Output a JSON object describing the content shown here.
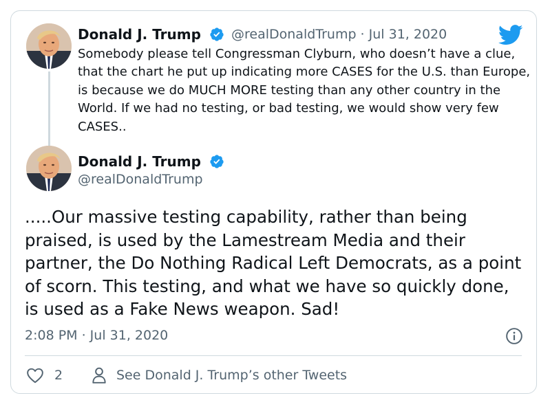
{
  "colors": {
    "accent": "#1d9bf0",
    "muted": "#536471",
    "text": "#0f1419",
    "border": "#cfd9de"
  },
  "quoted_tweet": {
    "author_name": "Donald J. Trump",
    "handle_and_date": "@realDonaldTrump · Jul 31, 2020",
    "text": "Somebody please tell Congressman Clyburn, who doesn’t have a clue, that the chart he put up indicating more CASES for the U.S. than Europe, is because we do MUCH MORE testing than any other country in the World. If we had no testing, or bad testing, we would show very few CASES..",
    "verified_icon": "verified-badge-icon",
    "platform_icon": "twitter-bird-icon"
  },
  "main_tweet": {
    "author_name": "Donald J. Trump",
    "handle": "@realDonaldTrump",
    "verified_icon": "verified-badge-icon",
    "text": ".....Our massive testing capability, rather than being praised, is used by the Lamestream Media and their partner, the Do Nothing Radical Left Democrats, as a point of scorn. This testing, and what we have so quickly done, is used as a Fake News weapon. Sad!",
    "timestamp": "2:08 PM · Jul 31, 2020",
    "info_icon": "info-icon"
  },
  "footer": {
    "like_count": "2",
    "like_icon": "heart-icon",
    "profile_icon": "person-icon",
    "other_tweets_label": "See Donald J. Trump’s other Tweets"
  }
}
